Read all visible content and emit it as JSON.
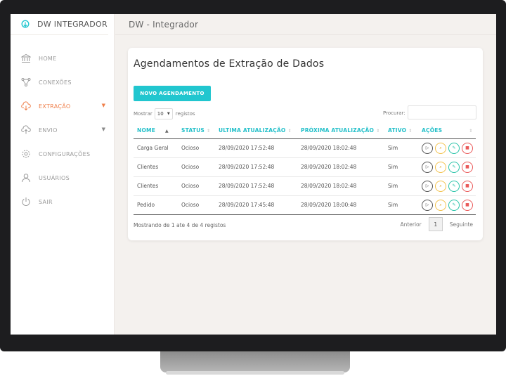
{
  "brand": {
    "name": "DW INTEGRADOR"
  },
  "topbar": {
    "title": "DW - Integrador"
  },
  "sidebar": {
    "items": [
      {
        "label": "HOME",
        "icon": "bank-icon"
      },
      {
        "label": "CONEXÕES",
        "icon": "network-icon"
      },
      {
        "label": "EXTRAÇÃO",
        "icon": "cloud-download-icon"
      },
      {
        "label": "ENVIO",
        "icon": "cloud-upload-icon"
      },
      {
        "label": "CONFIGURAÇÕES",
        "icon": "gear-icon"
      },
      {
        "label": "USUÁRIOS",
        "icon": "user-icon"
      },
      {
        "label": "SAIR",
        "icon": "power-icon"
      }
    ]
  },
  "page": {
    "title": "Agendamentos de Extração de Dados",
    "new_button": "NOVO AGENDAMENTO",
    "length": {
      "prefix": "Mostrar",
      "value": "10",
      "suffix": "registos"
    },
    "search": {
      "label": "Procurar:",
      "value": ""
    }
  },
  "table": {
    "headers": [
      "NOME",
      "STATUS",
      "ULTIMA ATUALIZAÇÃO",
      "PRÓXIMA ATUALIZAÇÃO",
      "ATIVO",
      "AÇÕES"
    ],
    "rows": [
      {
        "nome": "Carga Geral",
        "status": "Ocioso",
        "ultima": "28/09/2020 17:52:48",
        "proxima": "28/09/2020 18:02:48",
        "ativo": "Sim"
      },
      {
        "nome": "Clientes",
        "status": "Ocioso",
        "ultima": "28/09/2020 17:52:48",
        "proxima": "28/09/2020 18:02:48",
        "ativo": "Sim"
      },
      {
        "nome": "Clientes",
        "status": "Ocioso",
        "ultima": "28/09/2020 17:52:48",
        "proxima": "28/09/2020 18:02:48",
        "ativo": "Sim"
      },
      {
        "nome": "Pedido",
        "status": "Ocioso",
        "ultima": "28/09/2020 17:45:48",
        "proxima": "28/09/2020 18:00:48",
        "ativo": "Sim"
      }
    ]
  },
  "footer": {
    "info": "Mostrando de 1 ate 4 de 4 registos",
    "prev": "Anterior",
    "page": "1",
    "next": "Seguinte"
  },
  "colors": {
    "accent": "#21c6cf",
    "active_nav": "#ef7f4a"
  }
}
